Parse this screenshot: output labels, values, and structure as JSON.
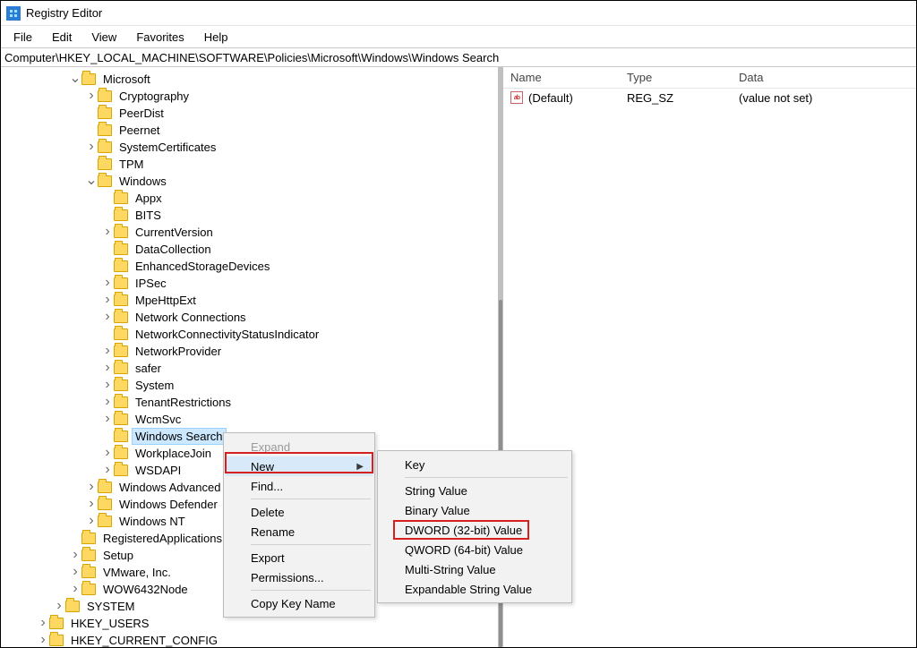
{
  "title": "Registry Editor",
  "menu": [
    "File",
    "Edit",
    "View",
    "Favorites",
    "Help"
  ],
  "address": "Computer\\HKEY_LOCAL_MACHINE\\SOFTWARE\\Policies\\Microsoft\\Windows\\Windows Search",
  "tree": [
    {
      "d": 4,
      "t": "v",
      "label": "Microsoft"
    },
    {
      "d": 5,
      "t": ">",
      "label": "Cryptography"
    },
    {
      "d": 5,
      "t": " ",
      "label": "PeerDist"
    },
    {
      "d": 5,
      "t": " ",
      "label": "Peernet"
    },
    {
      "d": 5,
      "t": ">",
      "label": "SystemCertificates"
    },
    {
      "d": 5,
      "t": " ",
      "label": "TPM"
    },
    {
      "d": 5,
      "t": "v",
      "label": "Windows"
    },
    {
      "d": 6,
      "t": " ",
      "label": "Appx"
    },
    {
      "d": 6,
      "t": " ",
      "label": "BITS"
    },
    {
      "d": 6,
      "t": ">",
      "label": "CurrentVersion"
    },
    {
      "d": 6,
      "t": " ",
      "label": "DataCollection"
    },
    {
      "d": 6,
      "t": " ",
      "label": "EnhancedStorageDevices"
    },
    {
      "d": 6,
      "t": ">",
      "label": "IPSec"
    },
    {
      "d": 6,
      "t": ">",
      "label": "MpeHttpExt"
    },
    {
      "d": 6,
      "t": ">",
      "label": "Network Connections"
    },
    {
      "d": 6,
      "t": " ",
      "label": "NetworkConnectivityStatusIndicator"
    },
    {
      "d": 6,
      "t": ">",
      "label": "NetworkProvider"
    },
    {
      "d": 6,
      "t": ">",
      "label": "safer"
    },
    {
      "d": 6,
      "t": ">",
      "label": "System"
    },
    {
      "d": 6,
      "t": ">",
      "label": "TenantRestrictions"
    },
    {
      "d": 6,
      "t": ">",
      "label": "WcmSvc"
    },
    {
      "d": 6,
      "t": " ",
      "label": "Windows Search",
      "selected": true
    },
    {
      "d": 6,
      "t": ">",
      "label": "WorkplaceJoin"
    },
    {
      "d": 6,
      "t": ">",
      "label": "WSDAPI"
    },
    {
      "d": 5,
      "t": ">",
      "label": "Windows Advanced Threat Protection"
    },
    {
      "d": 5,
      "t": ">",
      "label": "Windows Defender"
    },
    {
      "d": 5,
      "t": ">",
      "label": "Windows NT"
    },
    {
      "d": 4,
      "t": " ",
      "label": "RegisteredApplications"
    },
    {
      "d": 4,
      "t": ">",
      "label": "Setup"
    },
    {
      "d": 4,
      "t": ">",
      "label": "VMware, Inc."
    },
    {
      "d": 4,
      "t": ">",
      "label": "WOW6432Node"
    },
    {
      "d": 3,
      "t": ">",
      "label": "SYSTEM"
    },
    {
      "d": 2,
      "t": ">",
      "label": "HKEY_USERS"
    },
    {
      "d": 2,
      "t": ">",
      "label": "HKEY_CURRENT_CONFIG"
    }
  ],
  "list": {
    "headers": {
      "name": "Name",
      "type": "Type",
      "data": "Data"
    },
    "rows": [
      {
        "name": "(Default)",
        "type": "REG_SZ",
        "data": "(value not set)"
      }
    ]
  },
  "context1": {
    "expand": "Expand",
    "new": "New",
    "find": "Find...",
    "delete": "Delete",
    "rename": "Rename",
    "export": "Export",
    "perms": "Permissions...",
    "copy": "Copy Key Name"
  },
  "context2": {
    "key": "Key",
    "string": "String Value",
    "binary": "Binary Value",
    "dword": "DWORD (32-bit) Value",
    "qword": "QWORD (64-bit) Value",
    "multi": "Multi-String Value",
    "exp": "Expandable String Value"
  }
}
